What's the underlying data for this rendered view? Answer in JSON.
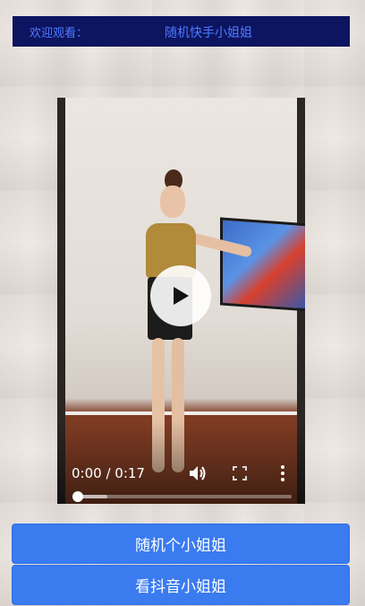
{
  "header": {
    "welcome_label": "欢迎观看：",
    "title": "随机快手小姐姐"
  },
  "player": {
    "time_display": "0:00 / 0:17",
    "progress_fraction": 0.0,
    "buffer_fraction": 0.14,
    "play_icon": "play-icon",
    "volume_icon": "volume-icon",
    "fullscreen_icon": "fullscreen-icon",
    "more_icon": "more-vertical-icon"
  },
  "buttons": {
    "random_label": "随机个小姐姐",
    "douyin_label": "看抖音小姐姐"
  },
  "colors": {
    "header_bg": "#0d1460",
    "header_text": "#4d7bff",
    "button_bg": "#3a7bf0"
  }
}
